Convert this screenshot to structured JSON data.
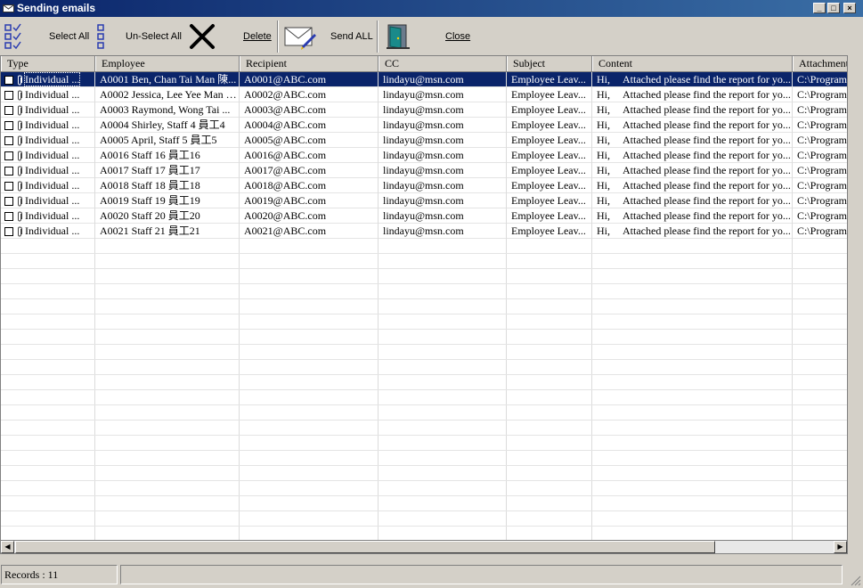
{
  "window": {
    "title": "Sending emails"
  },
  "toolbar": {
    "select_all": "Select All",
    "unselect_all": "Un-Select All",
    "delete": "Delete",
    "send_all": "Send ALL",
    "close": "Close"
  },
  "grid": {
    "columns": [
      "Type",
      "Employee",
      "Recipient",
      "CC",
      "Subject",
      "Content",
      "Attachment"
    ],
    "rows": [
      {
        "type": "Individual ...",
        "employee": "A0001 Ben, Chan Tai Man 陳...",
        "recipient": "A0001@ABC.com",
        "cc": "lindayu@msn.com",
        "subject": "Employee Leav...",
        "content_greet": "Hi,",
        "content": "Attached please find the report for yo...",
        "attachment": "C:\\Program"
      },
      {
        "type": "Individual ...",
        "employee": "A0002 Jessica, Lee Yee Man 李...",
        "recipient": "A0002@ABC.com",
        "cc": "lindayu@msn.com",
        "subject": "Employee Leav...",
        "content_greet": "Hi,",
        "content": "Attached please find the report for yo...",
        "attachment": "C:\\Program"
      },
      {
        "type": "Individual ...",
        "employee": "A0003 Raymond, Wong Tai ...",
        "recipient": "A0003@ABC.com",
        "cc": "lindayu@msn.com",
        "subject": "Employee Leav...",
        "content_greet": "Hi,",
        "content": "Attached please find the report for yo...",
        "attachment": "C:\\Program"
      },
      {
        "type": "Individual ...",
        "employee": "A0004 Shirley, Staff 4 員工4",
        "recipient": "A0004@ABC.com",
        "cc": "lindayu@msn.com",
        "subject": "Employee Leav...",
        "content_greet": "Hi,",
        "content": "Attached please find the report for yo...",
        "attachment": "C:\\Program"
      },
      {
        "type": "Individual ...",
        "employee": "A0005 April, Staff 5 員工5",
        "recipient": "A0005@ABC.com",
        "cc": "lindayu@msn.com",
        "subject": "Employee Leav...",
        "content_greet": "Hi,",
        "content": "Attached please find the report for yo...",
        "attachment": "C:\\Program"
      },
      {
        "type": "Individual ...",
        "employee": "A0016 Staff 16 員工16",
        "recipient": "A0016@ABC.com",
        "cc": "lindayu@msn.com",
        "subject": "Employee Leav...",
        "content_greet": "Hi,",
        "content": "Attached please find the report for yo...",
        "attachment": "C:\\Program"
      },
      {
        "type": "Individual ...",
        "employee": "A0017 Staff 17 員工17",
        "recipient": "A0017@ABC.com",
        "cc": "lindayu@msn.com",
        "subject": "Employee Leav...",
        "content_greet": "Hi,",
        "content": "Attached please find the report for yo...",
        "attachment": "C:\\Program"
      },
      {
        "type": "Individual ...",
        "employee": "A0018 Staff 18 員工18",
        "recipient": "A0018@ABC.com",
        "cc": "lindayu@msn.com",
        "subject": "Employee Leav...",
        "content_greet": "Hi,",
        "content": "Attached please find the report for yo...",
        "attachment": "C:\\Program"
      },
      {
        "type": "Individual ...",
        "employee": "A0019 Staff 19 員工19",
        "recipient": "A0019@ABC.com",
        "cc": "lindayu@msn.com",
        "subject": "Employee Leav...",
        "content_greet": "Hi,",
        "content": "Attached please find the report for yo...",
        "attachment": "C:\\Program"
      },
      {
        "type": "Individual ...",
        "employee": "A0020 Staff 20 員工20",
        "recipient": "A0020@ABC.com",
        "cc": "lindayu@msn.com",
        "subject": "Employee Leav...",
        "content_greet": "Hi,",
        "content": "Attached please find the report for yo...",
        "attachment": "C:\\Program"
      },
      {
        "type": "Individual ...",
        "employee": "A0021 Staff 21 員工21",
        "recipient": "A0021@ABC.com",
        "cc": "lindayu@msn.com",
        "subject": "Employee Leav...",
        "content_greet": "Hi,",
        "content": "Attached please find the report for yo...",
        "attachment": "C:\\Program"
      }
    ],
    "selected_row": 0
  },
  "status": {
    "records": "Records : 11"
  },
  "colors": {
    "selection": "#0a246a",
    "titlebar": "#0a246a"
  }
}
